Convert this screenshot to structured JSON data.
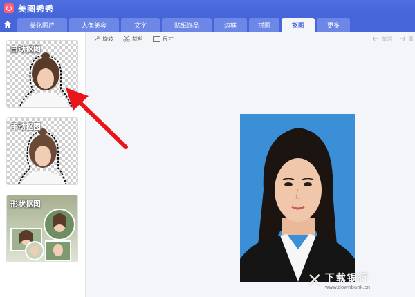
{
  "app": {
    "title": "美图秀秀"
  },
  "tabs": [
    {
      "label": "美化图片"
    },
    {
      "label": "人像美容"
    },
    {
      "label": "文字"
    },
    {
      "label": "贴纸饰品"
    },
    {
      "label": "边框"
    },
    {
      "label": "拼图"
    },
    {
      "label": "抠图",
      "active": true
    },
    {
      "label": "更多"
    }
  ],
  "toolbar": {
    "rotate": "旋转",
    "crop": "裁剪",
    "size": "尺寸",
    "undo": "撤销",
    "redo": "重"
  },
  "cutout_modes": [
    {
      "label": "自动抠图"
    },
    {
      "label": "手动抠图"
    },
    {
      "label": "形状抠图"
    }
  ],
  "watermark": {
    "main": "下载银行",
    "sub": "www.downbank.cn"
  },
  "colors": {
    "titlebar": "#4565d8",
    "accent": "#ff5c7a",
    "photo_bg": "#3a8fd6",
    "arrow": "#e8151b"
  }
}
